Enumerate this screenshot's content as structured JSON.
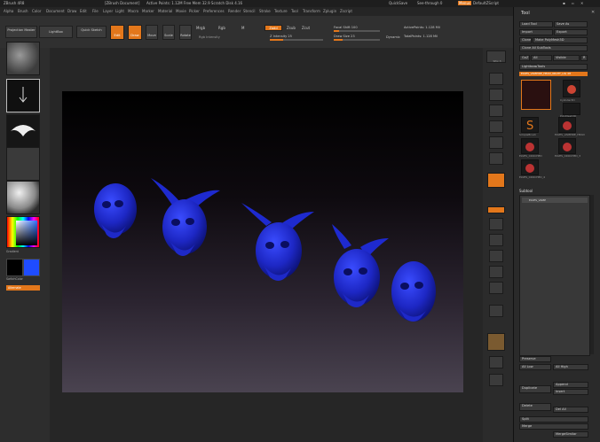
{
  "titlebar": {
    "app": "ZBrush 4R8",
    "doc": "[ZBrush Document]",
    "stats": "Active Points: 1.12M   Free Mem 32.9   Scratch Disk 4.16",
    "quicksave": "QuickSave",
    "see_through": "See-through 0",
    "menus": "Menus",
    "default_script": "DefaultZScript"
  },
  "menus": [
    "Alpha",
    "Brush",
    "Color",
    "Document",
    "Draw",
    "Edit",
    "File",
    "Layer",
    "Light",
    "Macro",
    "Marker",
    "Material",
    "Movie",
    "Picker",
    "Preferences",
    "Render",
    "Stencil",
    "Stroke",
    "Texture",
    "Tool",
    "Transform",
    "Zplugin",
    "Zscript"
  ],
  "toolbar": {
    "projection_master": "Projection Master",
    "lightbox": "LightBox",
    "quick_sketch": "Quick Sketch",
    "edit": "Edit",
    "draw": "Draw",
    "move": "Move",
    "scale": "Scale",
    "rotate": "Rotate",
    "mrgb": "Mrgb",
    "rgb": "Rgb",
    "m": "M",
    "zadd": "Zadd",
    "zsub": "Zsub",
    "zcut": "Zcut",
    "rgb_intensity": "Rgb Intensity",
    "z_intensity": "Z Intensity 25",
    "focal_shift": "Focal Shift 100",
    "draw_size": "Draw Size 23",
    "dynamic": "Dynamic",
    "active_points": "ActivePoints: 1.128 Mil",
    "total_points": "TotalPoints: 1.128 Mil"
  },
  "left_shelf": {
    "gradient": "Gradient",
    "switch_color": "SwitchColor",
    "alternate": "Alternate"
  },
  "right_shelf": {
    "labels": [
      "BPR",
      "SPix 3",
      "Scroll",
      "Zoom",
      "Actual",
      "AAHalf",
      "Persp",
      "Floor",
      "Local",
      "XYZ",
      "Frame",
      "Move",
      "Scale",
      "Rotate",
      "Transp",
      "Solo",
      "Xpose"
    ]
  },
  "tool_panel": {
    "title": "Tool",
    "load_tool": "Load Tool",
    "save_as": "Save As",
    "import": "Import",
    "export": "Export",
    "clone": "Clone",
    "make_polymesh": "Make PolyMesh3D",
    "goz": "GoZ",
    "all": "All",
    "visible": "Visible",
    "r": "R",
    "lightbox_tools": "Lightbox▸Tools",
    "current_tool": "ELVES_VAMPIRE_HEAD_NIGHT_LIG 48",
    "tools": [
      "Cylinder3D",
      "PolyMesh3D",
      "SimpleBrush",
      "ELVES_VAMPIRE_HEAD",
      "ELVES_CROCHED",
      "ELVES_CROCHED_3",
      "ELVES_CROCHED_4"
    ],
    "subtool": "Subtool",
    "subtool_item": "ELVES_VAMP",
    "preserve": "Preserve",
    "all_low": "All Low",
    "all_high": "All High",
    "append": "Append",
    "insert": "Insert",
    "duplicate": "Duplicate",
    "delete": "Delete",
    "del_all": "Del All",
    "split": "Split",
    "merge": "Merge",
    "merge_similar": "MergeSimilar"
  },
  "colors": {
    "accent": "#e3771b",
    "model": "#1f2bd0",
    "panel": "#2a2a2a"
  }
}
